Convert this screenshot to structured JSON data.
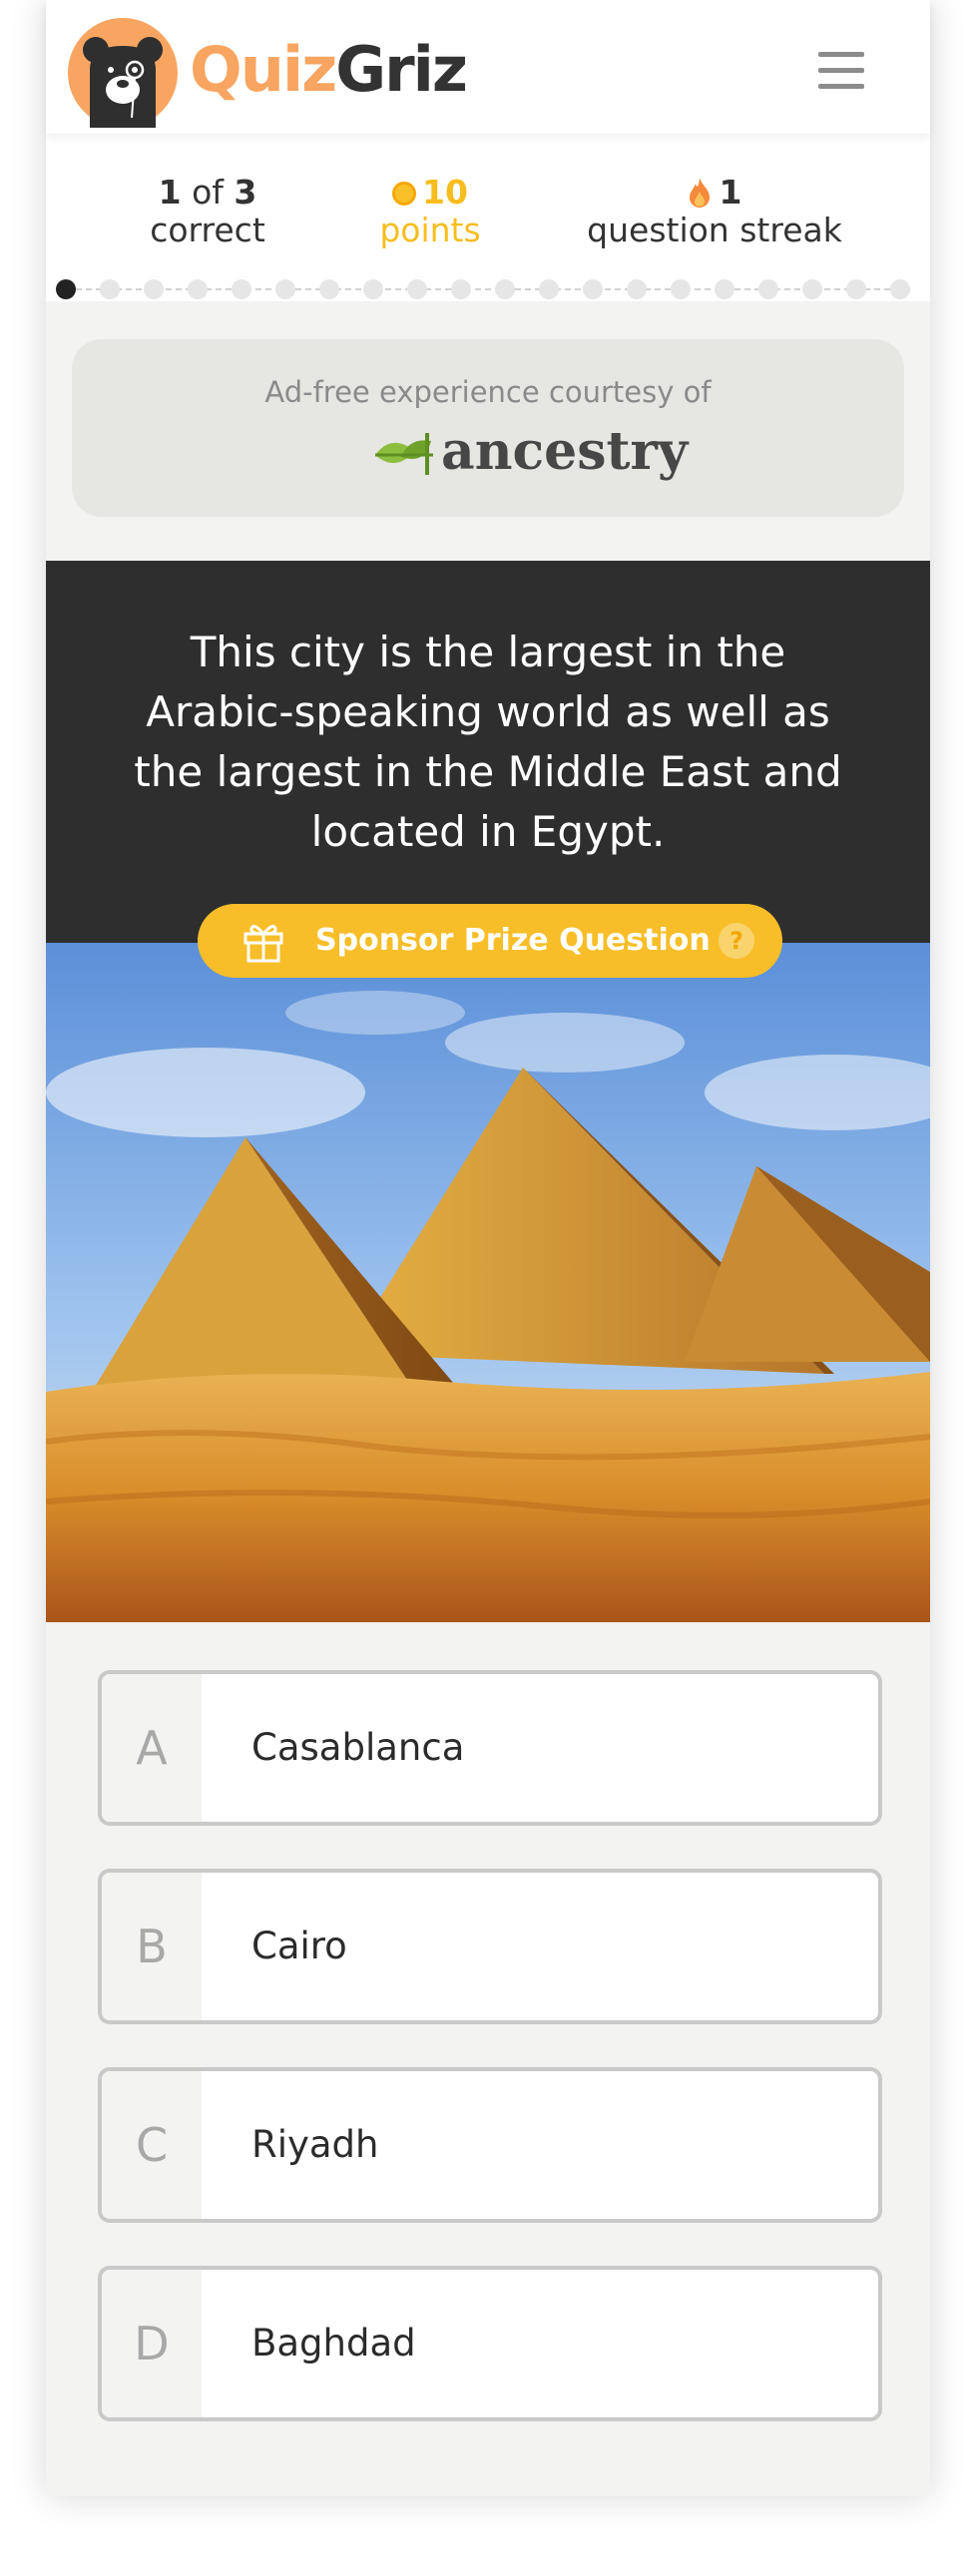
{
  "header": {
    "brand_first": "Quiz",
    "brand_second": "Griz",
    "menu_icon": "hamburger-menu-icon"
  },
  "stats": {
    "correct_count": "1",
    "correct_of": "of",
    "correct_total": "3",
    "correct_label": "correct",
    "points_value": "10",
    "points_label": "points",
    "streak_value": "1",
    "streak_label": "question streak",
    "points_color": "#f7bd1f"
  },
  "progress": {
    "current_question": 1,
    "total_dots": 20
  },
  "ad": {
    "text": "Ad-free experience courtesy of",
    "sponsor_name": "ancestry"
  },
  "question": {
    "text": "This city is the largest in the Arabic-speaking world as well as the largest in the Middle East and located in Egypt.",
    "sponsor_label": "Sponsor Prize Question",
    "help_label": "?",
    "image": "pyramids-of-giza-photo"
  },
  "answers": [
    {
      "letter": "A",
      "text": "Casablanca"
    },
    {
      "letter": "B",
      "text": "Cairo"
    },
    {
      "letter": "C",
      "text": "Riyadh"
    },
    {
      "letter": "D",
      "text": "Baghdad"
    }
  ],
  "colors": {
    "brand_orange": "#f7a561",
    "sponsor_yellow": "#f7be29",
    "question_bg": "#2e2e2e",
    "page_bg": "#f3f3f1"
  }
}
